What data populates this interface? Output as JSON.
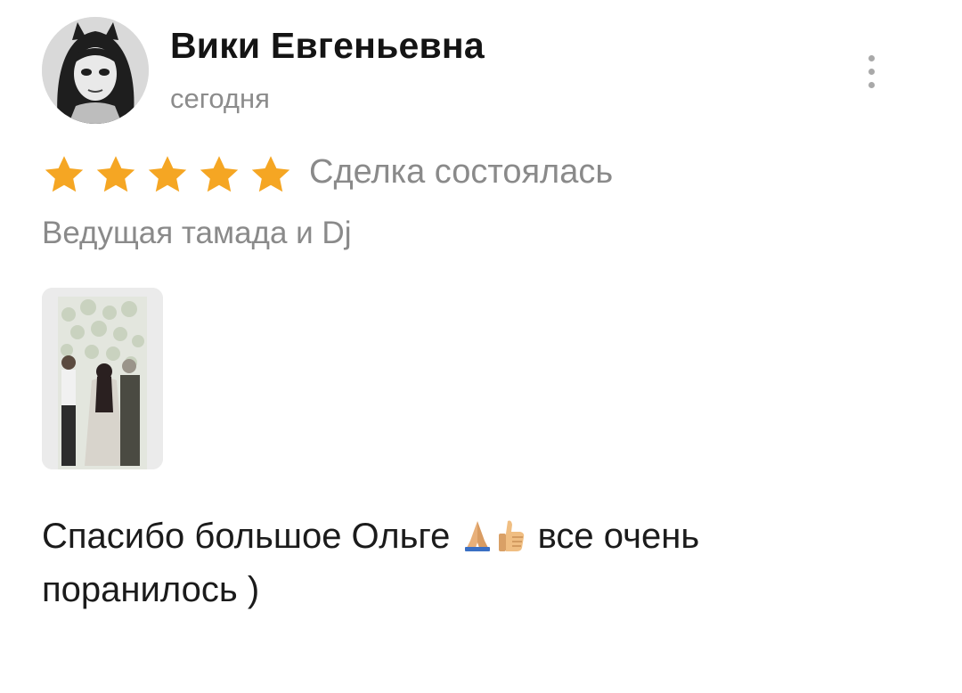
{
  "review": {
    "author_name": "Вики Евгеньевна",
    "date": "сегодня",
    "rating": 5,
    "rating_max": 5,
    "deal_status": "Сделка состоялась",
    "service": "Ведущая тамада и Dj",
    "text_part1": "Спасибо большое Ольге",
    "text_part2": "все очень поранилось )",
    "emojis": [
      "folded-hands-icon",
      "thumbs-up-icon"
    ]
  },
  "colors": {
    "star": "#F5A623",
    "secondary_text": "#8A8A8A",
    "primary_text": "#1A1A1A"
  },
  "icons": {
    "menu": "more-vertical-icon",
    "star": "star-icon"
  }
}
